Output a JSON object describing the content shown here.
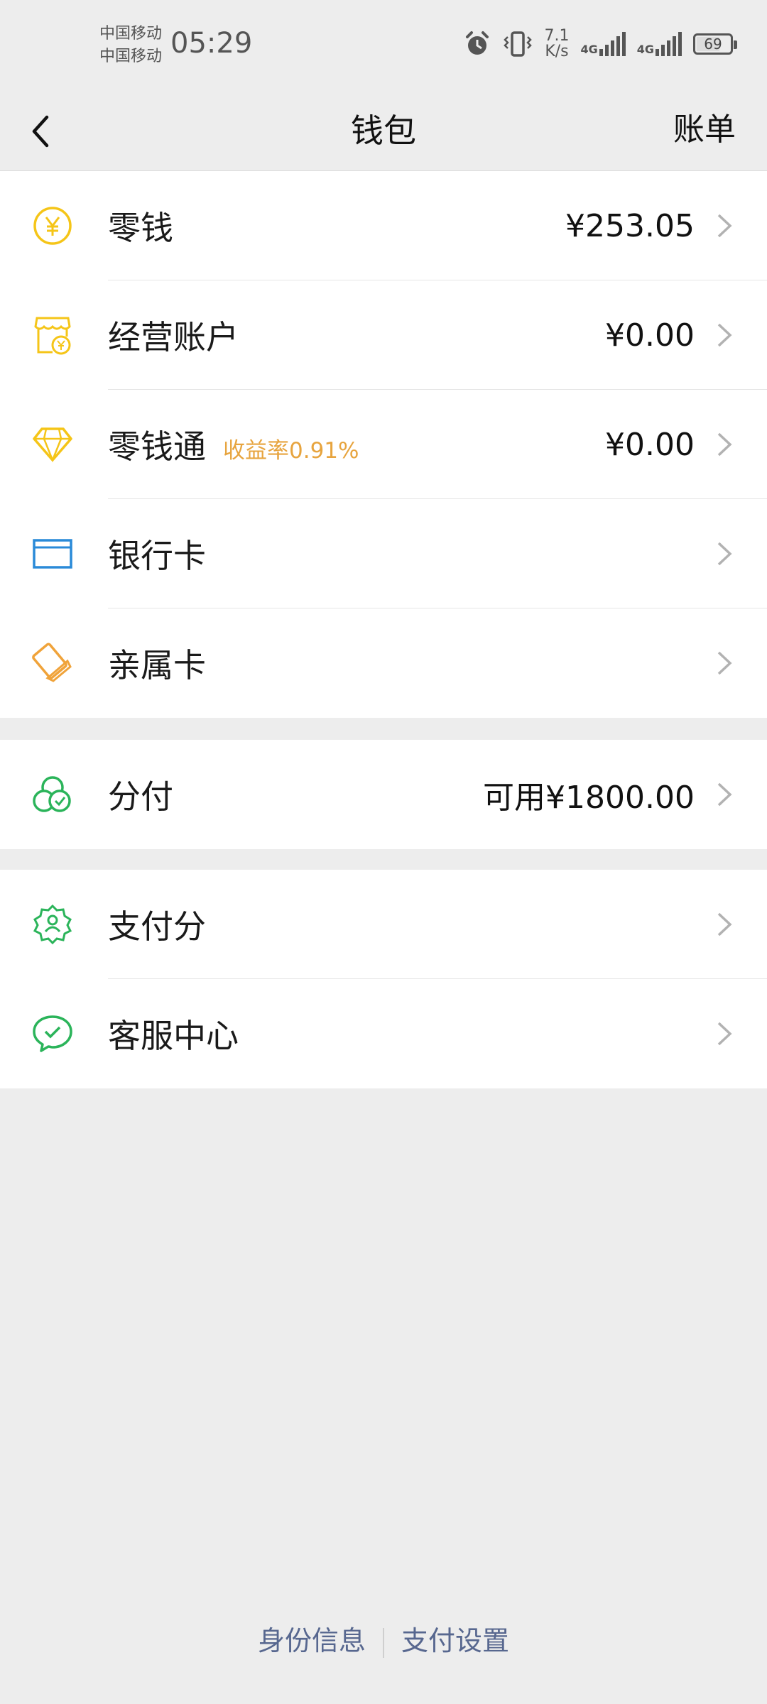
{
  "status_bar": {
    "carrier1": "中国移动",
    "carrier2": "中国移动",
    "time": "05:29",
    "speed_value": "7.1",
    "speed_unit": "K/s",
    "net1": "4G",
    "net2": "4G",
    "battery": "69",
    "battery_level": 0.69
  },
  "header": {
    "title": "钱包",
    "right_action": "账单"
  },
  "group1": [
    {
      "label": "零钱",
      "value": "¥253.05",
      "icon": "yuan-coin-icon",
      "color": "#f5c518"
    },
    {
      "label": "经营账户",
      "value": "¥0.00",
      "icon": "shop-account-icon",
      "color": "#f5c518"
    },
    {
      "label": "零钱通",
      "tag": "收益率0.91%",
      "value": "¥0.00",
      "icon": "diamond-icon",
      "color": "#f5c518"
    },
    {
      "label": "银行卡",
      "value": "",
      "icon": "bank-card-icon",
      "color": "#2a8ad8"
    },
    {
      "label": "亲属卡",
      "value": "",
      "icon": "family-card-icon",
      "color": "#f0a33a"
    }
  ],
  "group2": [
    {
      "label": "分付",
      "value": "可用¥1800.00",
      "icon": "fenfu-icon",
      "color": "#2bb45a"
    }
  ],
  "group3": [
    {
      "label": "支付分",
      "value": "",
      "icon": "payscore-icon",
      "color": "#2bb45a"
    },
    {
      "label": "客服中心",
      "value": "",
      "icon": "customer-service-icon",
      "color": "#2bb45a"
    }
  ],
  "footer": {
    "left": "身份信息",
    "right": "支付设置"
  },
  "colors": {
    "accent_tag": "#e7a43e",
    "footer_link": "#57678f"
  }
}
